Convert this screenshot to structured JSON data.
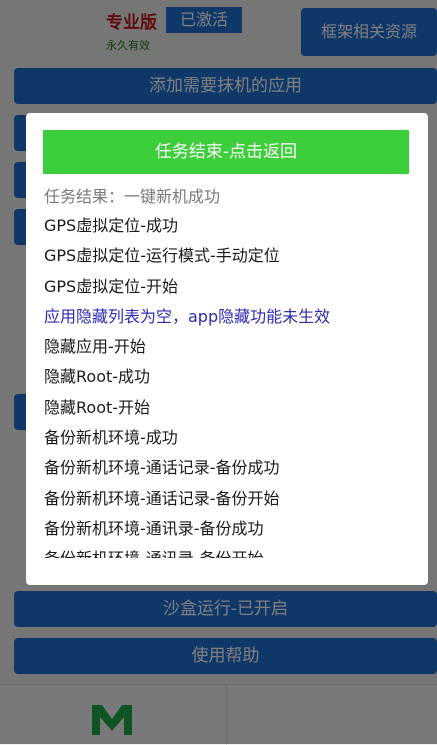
{
  "header": {
    "pro_label": "专业版",
    "activated_label": "已激活",
    "validity_label": "永久有效",
    "framework_button": "框架相关资源"
  },
  "main": {
    "add_app_button": "添加需要抹机的应用",
    "sandbox_button": "沙盒运行-已开启",
    "help_button": "使用帮助"
  },
  "dialog": {
    "return_button": "任务结束-点击返回",
    "result_text": "任务结果：一键新机成功",
    "log": [
      {
        "text": "GPS虚拟定位-成功",
        "warn": false
      },
      {
        "text": "GPS虚拟定位-运行模式-手动定位",
        "warn": false
      },
      {
        "text": "GPS虚拟定位-开始",
        "warn": false
      },
      {
        "text": "应用隐藏列表为空，app隐藏功能未生效",
        "warn": true
      },
      {
        "text": "隐藏应用-开始",
        "warn": false
      },
      {
        "text": "隐藏Root-成功",
        "warn": false
      },
      {
        "text": "隐藏Root-开始",
        "warn": false
      },
      {
        "text": "备份新机环境-成功",
        "warn": false
      },
      {
        "text": "备份新机环境-通话记录-备份成功",
        "warn": false
      },
      {
        "text": "备份新机环境-通话记录-备份开始",
        "warn": false
      },
      {
        "text": "备份新机环境-通讯录-备份成功",
        "warn": false
      },
      {
        "text": "备份新机环境-通讯录-备份开始",
        "warn": false
      }
    ]
  },
  "colors": {
    "primary_blue": "#1f6fd1",
    "success_green": "#3dcf3b",
    "pro_red": "#c0181c",
    "warn_text": "#2b2bb0"
  },
  "icons": {
    "bottom_logo": "m-logo-icon"
  }
}
